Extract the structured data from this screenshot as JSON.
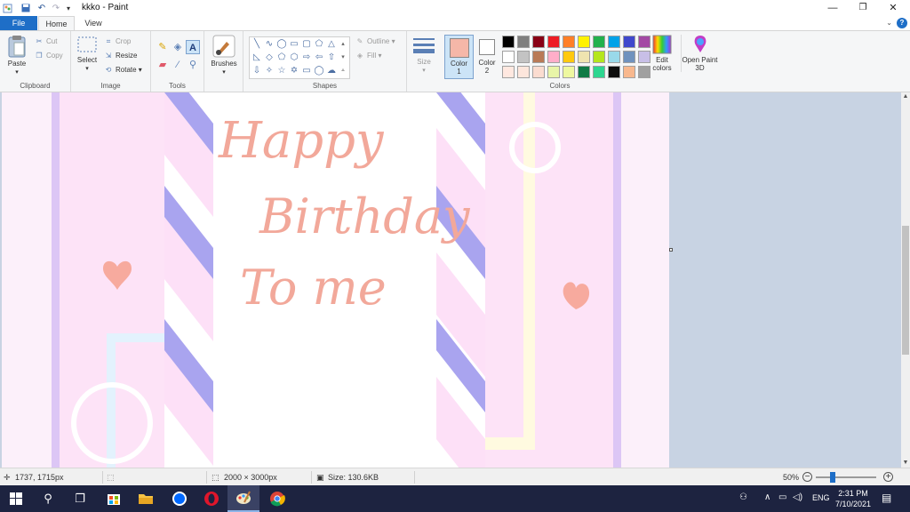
{
  "window": {
    "title": "kkko - Paint",
    "minimize_glyph": "—",
    "restore_glyph": "❐",
    "close_glyph": "✕"
  },
  "tabs": [
    {
      "label": "File"
    },
    {
      "label": "Home"
    },
    {
      "label": "View"
    }
  ],
  "ribbon": {
    "clipboard": {
      "label": "Clipboard",
      "paste": "Paste",
      "cut": "Cut",
      "copy": "Copy"
    },
    "image": {
      "label": "Image",
      "select": "Select",
      "crop": "Crop",
      "resize": "Resize",
      "rotate": "Rotate"
    },
    "tools": {
      "label": "Tools"
    },
    "brushes": {
      "label": "Brushes"
    },
    "shapes": {
      "label": "Shapes",
      "outline": "Outline",
      "fill": "Fill"
    },
    "size": {
      "label": "Size"
    },
    "color1": {
      "label": "Color",
      "num": "1",
      "value": "#f5b7a8"
    },
    "color2": {
      "label": "Color",
      "num": "2",
      "value": "#ffffff"
    },
    "colors": {
      "label": "Colors",
      "row1": [
        "#000000",
        "#7f7f7f",
        "#880015",
        "#ed1c24",
        "#ff7f27",
        "#fff200",
        "#22b14c",
        "#00a2e8",
        "#3f48cc",
        "#a349a4"
      ],
      "row2": [
        "#ffffff",
        "#c3c3c3",
        "#b97a57",
        "#ffaec9",
        "#ffc90e",
        "#efe4b0",
        "#b5e61d",
        "#99d9ea",
        "#7092be",
        "#c8bfe7"
      ],
      "row3": [
        "#ffe8e0",
        "#fde6dc",
        "#fbdcd0",
        "#e8f5a8",
        "#eef8a0",
        "#0f7a45",
        "#2ed690",
        "#0d0d0d",
        "#f8b88e",
        "#a0a0a0"
      ]
    },
    "edit_colors": "Edit colors",
    "paint3d": "Open Paint 3D"
  },
  "artwork": {
    "line1": "Happy",
    "line2": "Birthday",
    "line3": "To me"
  },
  "statusbar": {
    "cursor": "1737, 1715px",
    "dimensions": "2000 × 3000px",
    "size": "Size: 130.6KB",
    "zoom": "50%"
  },
  "taskbar": {
    "lang": "ENG",
    "time": "2:31 PM",
    "date": "7/10/2021",
    "apps": [
      "start",
      "search",
      "task-view",
      "store",
      "file-explorer",
      "zalo",
      "opera",
      "paint",
      "chrome"
    ]
  }
}
